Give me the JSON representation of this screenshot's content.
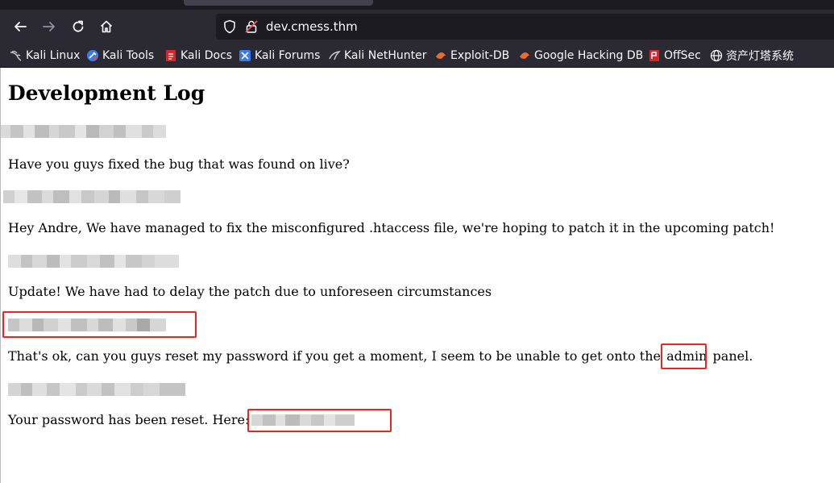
{
  "browser": {
    "url": "dev.cmess.thm",
    "bookmarks": [
      {
        "label": "Kali Linux",
        "icon": "kali-dragon-icon"
      },
      {
        "label": "Kali Tools",
        "icon": "kali-tools-icon"
      },
      {
        "label": "Kali Docs",
        "icon": "kali-docs-icon"
      },
      {
        "label": "Kali Forums",
        "icon": "kali-forums-icon"
      },
      {
        "label": "Kali NetHunter",
        "icon": "kali-nethunter-icon"
      },
      {
        "label": "Exploit-DB",
        "icon": "exploit-db-icon"
      },
      {
        "label": "Google Hacking DB",
        "icon": "ghdb-icon"
      },
      {
        "label": "OffSec",
        "icon": "offsec-icon"
      },
      {
        "label": "资产灯塔系统",
        "icon": "globe-icon"
      }
    ]
  },
  "page": {
    "title": "Development Log",
    "entries": [
      {
        "message": "Have you guys fixed the bug that was found on live?"
      },
      {
        "message": "Hey Andre, We have managed to fix the misconfigured .htaccess file, we're hoping to patch it in the upcoming patch!"
      },
      {
        "message": "Update! We have had to delay the patch due to unforeseen circumstances"
      },
      {
        "message_before": "That's ok, can you guys reset my password if you get a moment, I seem to be unable to get onto the",
        "highlight": "admin",
        "message_after": "panel."
      },
      {
        "message": "Your password has been reset. Here:"
      }
    ]
  }
}
